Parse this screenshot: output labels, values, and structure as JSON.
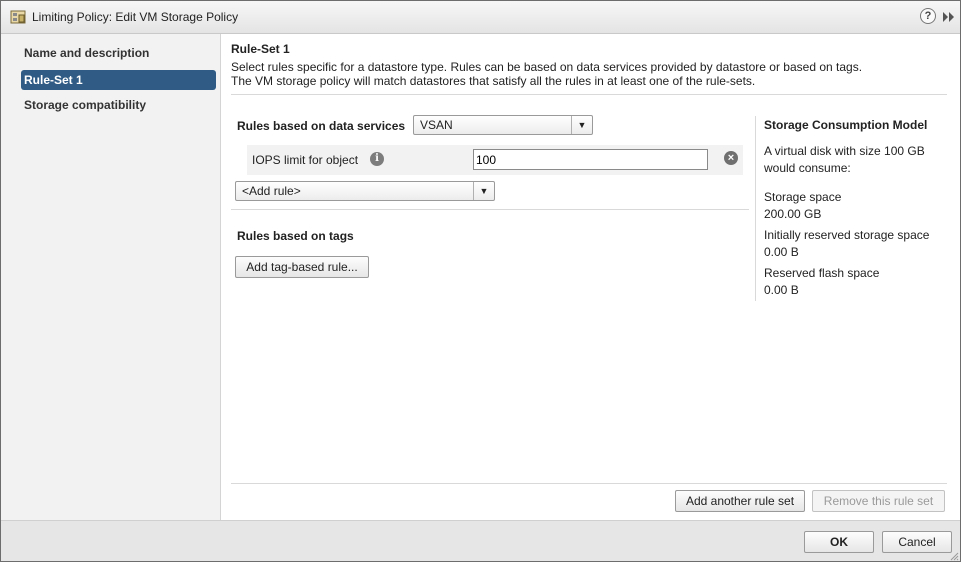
{
  "window": {
    "title": "Limiting Policy: Edit VM Storage Policy",
    "help_label": "?",
    "icons": [
      "storage-policy-icon",
      "help-icon",
      "expand-icon"
    ]
  },
  "nav": {
    "items": [
      {
        "label": "Name and description",
        "active": false
      },
      {
        "label": "Rule-Set 1",
        "active": true
      },
      {
        "label": "Storage compatibility",
        "active": false
      }
    ]
  },
  "ruleset": {
    "title": "Rule-Set 1",
    "description_line1": "Select rules specific for a datastore type. Rules can be based on data services provided by datastore or based on tags.",
    "description_line2": "The VM storage policy will match datastores that satisfy all the rules in at least one of the rule-sets."
  },
  "data_services": {
    "label": "Rules based on data services",
    "selected_provider": "VSAN",
    "rules": [
      {
        "name": "IOPS limit for object",
        "value": "100"
      }
    ],
    "add_rule_label": "<Add rule>"
  },
  "tags": {
    "label": "Rules based on tags",
    "add_button": "Add tag-based rule..."
  },
  "consumption_model": {
    "title": "Storage Consumption Model",
    "intro": "A virtual disk with size 100 GB would consume:",
    "storage_space_label": "Storage space",
    "storage_space_value": "200.00 GB",
    "reserved_label": "Initially reserved storage space",
    "reserved_value": "0.00 B",
    "flash_label": "Reserved flash space",
    "flash_value": "0.00 B"
  },
  "ruleset_actions": {
    "add": "Add another rule set",
    "remove": "Remove this rule set"
  },
  "footer": {
    "ok": "OK",
    "cancel": "Cancel"
  },
  "colors": {
    "nav_active": "#2f5b85",
    "nav_bg": "#f2f2f2",
    "footer_bg": "#e6e6e6"
  }
}
